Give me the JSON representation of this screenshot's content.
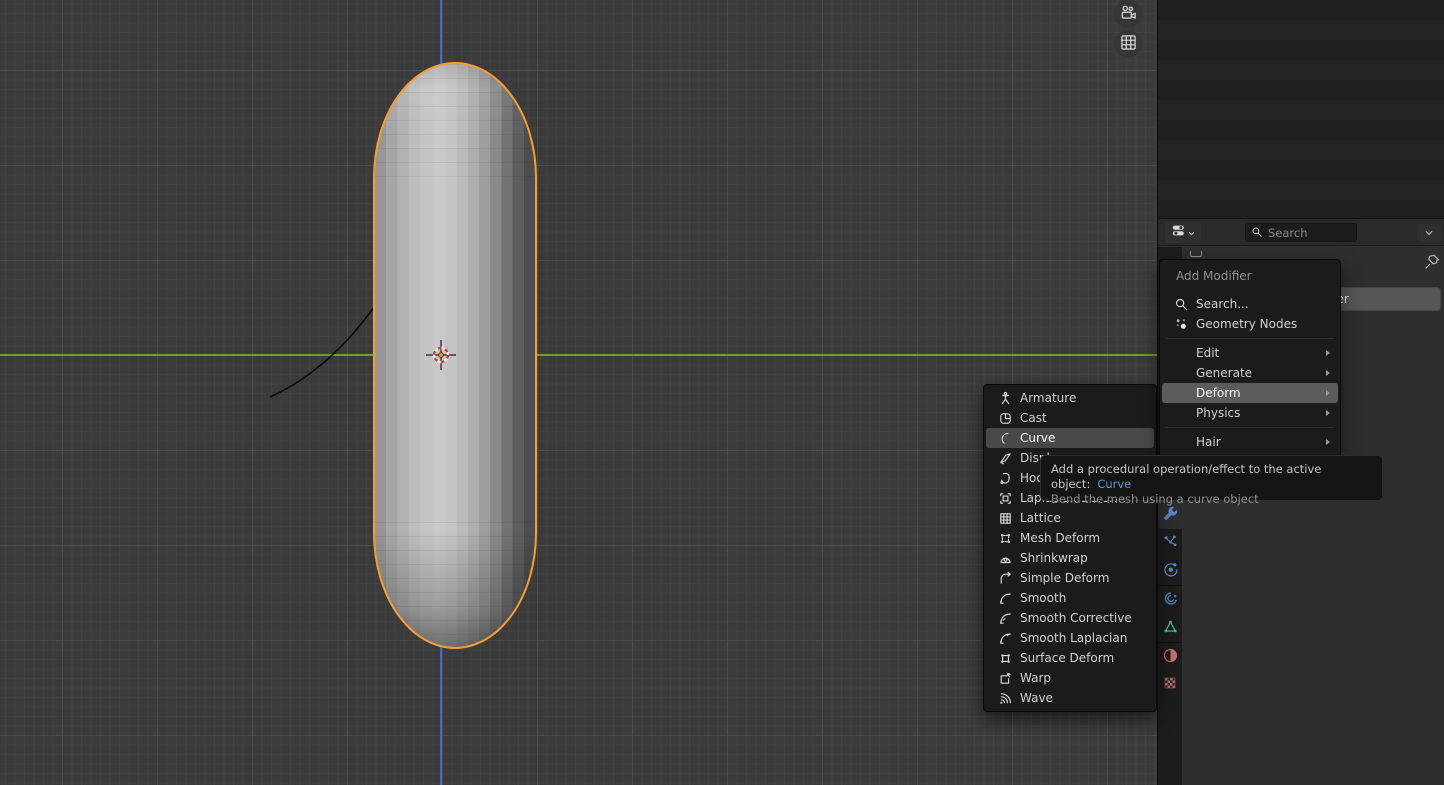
{
  "viewport": {
    "gizmos": [
      {
        "icon": "camera-view"
      },
      {
        "icon": "grid-ortho"
      }
    ],
    "objects": {
      "mesh": "capsule",
      "curve": "bezier-curve"
    },
    "colors": {
      "selection_outline": "#f79d33",
      "axis_y": "#6c9d33",
      "axis_z": "#3f6bc9"
    }
  },
  "properties": {
    "header": {
      "search_placeholder": "Search"
    },
    "add_modifier_label": "Add Modifier",
    "tabs": [
      {
        "icon": "wrench",
        "name": "modifier-properties",
        "active": true
      },
      {
        "icon": "particles",
        "name": "particle-properties"
      },
      {
        "icon": "physics",
        "name": "physics-properties"
      },
      {
        "icon": "constraints",
        "name": "constraint-properties"
      },
      {
        "icon": "object-data",
        "name": "object-data-properties"
      },
      {
        "icon": "material",
        "name": "material-properties"
      },
      {
        "icon": "texture",
        "name": "texture-properties"
      }
    ]
  },
  "add_menu": {
    "title": "Add Modifier",
    "actions": [
      {
        "icon": "search",
        "label": "Search..."
      },
      {
        "icon": "geometry-nodes",
        "label": "Geometry Nodes"
      }
    ],
    "groups": [
      [
        {
          "label": "Edit"
        },
        {
          "label": "Generate"
        },
        {
          "label": "Deform",
          "highlighted": true
        },
        {
          "label": "Physics"
        }
      ],
      [
        {
          "label": "Hair"
        }
      ]
    ]
  },
  "deform_submenu": {
    "items": [
      {
        "icon": "armature",
        "label": "Armature"
      },
      {
        "icon": "cast",
        "label": "Cast"
      },
      {
        "icon": "curve",
        "label": "Curve",
        "highlighted": true
      },
      {
        "icon": "displace",
        "label": "Displace"
      },
      {
        "icon": "hook",
        "label": "Hook"
      },
      {
        "icon": "laplacian-deform",
        "label": "Laplacian Deform"
      },
      {
        "icon": "lattice",
        "label": "Lattice"
      },
      {
        "icon": "mesh-deform",
        "label": "Mesh Deform"
      },
      {
        "icon": "shrinkwrap",
        "label": "Shrinkwrap"
      },
      {
        "icon": "simple-deform",
        "label": "Simple Deform"
      },
      {
        "icon": "smooth",
        "label": "Smooth"
      },
      {
        "icon": "smooth-corrective",
        "label": "Smooth Corrective"
      },
      {
        "icon": "smooth-laplacian",
        "label": "Smooth Laplacian"
      },
      {
        "icon": "surface-deform",
        "label": "Surface Deform"
      },
      {
        "icon": "warp",
        "label": "Warp"
      },
      {
        "icon": "wave",
        "label": "Wave"
      }
    ]
  },
  "tooltip": {
    "line1": "Add a procedural operation/effect to the active object:",
    "highlight": "Curve",
    "line2": "Bend the mesh using a curve object"
  }
}
